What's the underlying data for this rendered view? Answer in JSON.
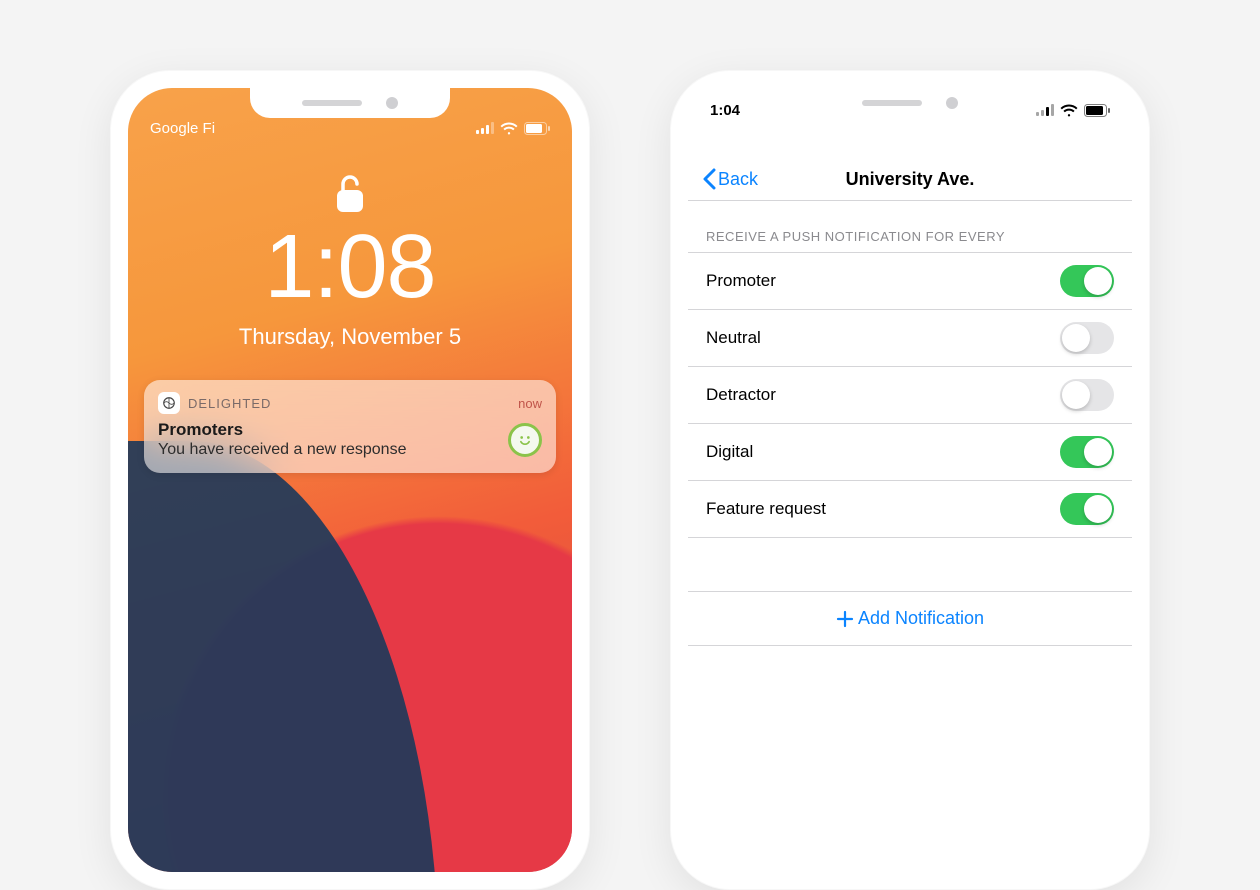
{
  "left": {
    "carrier": "Google Fi",
    "time": "1:08",
    "date": "Thursday, November 5",
    "notification": {
      "app": "DELIGHTED",
      "timestamp": "now",
      "title": "Promoters",
      "message": "You have received a new response",
      "smiley": "smiley-icon"
    }
  },
  "right": {
    "status_time": "1:04",
    "back_label": "Back",
    "title": "University Ave.",
    "section_header": "RECEIVE A PUSH NOTIFICATION FOR EVERY",
    "rows": [
      {
        "label": "Promoter",
        "on": true
      },
      {
        "label": "Neutral",
        "on": false
      },
      {
        "label": "Detractor",
        "on": false
      },
      {
        "label": "Digital",
        "on": true
      },
      {
        "label": "Feature request",
        "on": true
      }
    ],
    "add_label": "Add Notification"
  },
  "colors": {
    "ios_blue": "#0b84ff",
    "ios_green": "#34c759"
  }
}
